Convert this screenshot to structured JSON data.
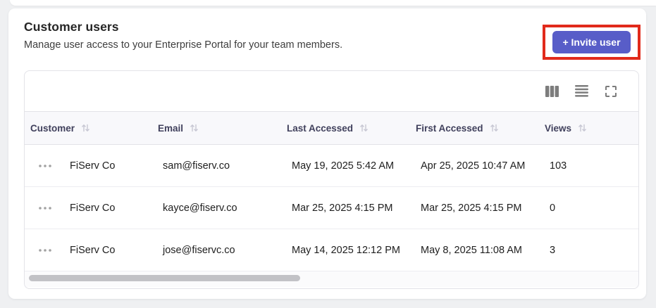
{
  "card": {
    "title": "Customer users",
    "subtitle": "Manage user access to your Enterprise Portal for your team members.",
    "invite_button_label": "+ Invite user"
  },
  "colors": {
    "accent_indigo": "#585dc8",
    "annotation_red": "#e12a1b",
    "header_bg": "#f8f8fb",
    "icon_gray": "#7d7d7d"
  },
  "toolbar": {
    "icons": [
      "columns-icon",
      "row-lines-icon",
      "fullscreen-icon"
    ]
  },
  "table": {
    "columns": [
      {
        "label": "Customer"
      },
      {
        "label": "Email"
      },
      {
        "label": "Last Accessed"
      },
      {
        "label": "First Accessed"
      },
      {
        "label": "Views"
      }
    ],
    "rows": [
      {
        "customer": "FiServ Co",
        "email": "sam@fiserv.co",
        "last_accessed": "May 19, 2025 5:42 AM",
        "first_accessed": "Apr 25, 2025 10:47 AM",
        "views": "103"
      },
      {
        "customer": "FiServ Co",
        "email": "kayce@fiserv.co",
        "last_accessed": "Mar 25, 2025 4:15 PM",
        "first_accessed": "Mar 25, 2025 4:15 PM",
        "views": "0"
      },
      {
        "customer": "FiServ Co",
        "email": "jose@fiservc.co",
        "last_accessed": "May 14, 2025 12:12 PM",
        "first_accessed": "May 8, 2025 11:08 AM",
        "views": "3"
      }
    ]
  }
}
